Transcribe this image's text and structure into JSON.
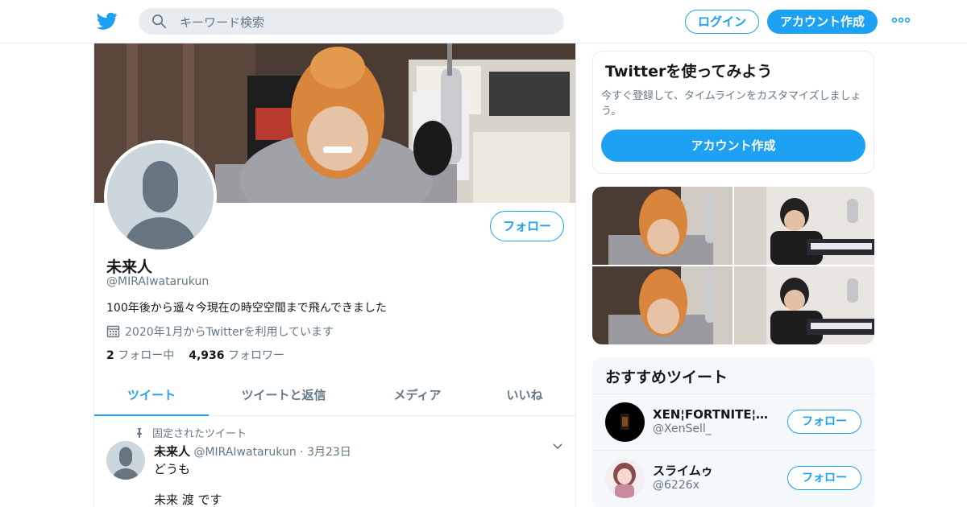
{
  "colors": {
    "accent": "#1da1f2",
    "secondary_text": "#657786",
    "primary_text": "#14171a",
    "border": "#e6ecf0"
  },
  "header": {
    "logo_icon": "twitter-bird-icon",
    "search": {
      "placeholder": "キーワード検索",
      "icon": "search-icon"
    },
    "login_label": "ログイン",
    "signup_label": "アカウント作成",
    "more_icon": "more-dots-icon"
  },
  "profile": {
    "name": "未来人",
    "handle": "@MIRAIwatarukun",
    "bio": "100年後から遥々今現在の時空空間まで飛んできました",
    "joined": "2020年1月からTwitterを利用しています",
    "following_count": "2",
    "following_label": "フォロー中",
    "followers_count": "4,936",
    "followers_label": "フォロワー",
    "follow_label": "フォロー"
  },
  "tabs": [
    {
      "label": "ツイート",
      "active": true
    },
    {
      "label": "ツイートと返信",
      "active": false
    },
    {
      "label": "メディア",
      "active": false
    },
    {
      "label": "いいね",
      "active": false
    }
  ],
  "pinned_tweet": {
    "pinned_label": "固定されたツイート",
    "name": "未来人",
    "handle": "@MIRAIwatarukun",
    "separator": "·",
    "date": "3月23日",
    "line1": "どうも",
    "line2": "未来 渡 です"
  },
  "signup_card": {
    "title": "Twitterを使ってみよう",
    "description": "今すぐ登録して、タイムラインをカスタマイズしましょう。",
    "button_label": "アカウント作成"
  },
  "recommendations": {
    "title": "おすすめツイート",
    "items": [
      {
        "name": "XEN¦FORTNITE¦情報",
        "handle": "@XenSell_",
        "follow_label": "フォロー"
      },
      {
        "name": "スライムゥ",
        "handle": "@6226x",
        "follow_label": "フォロー"
      }
    ]
  }
}
